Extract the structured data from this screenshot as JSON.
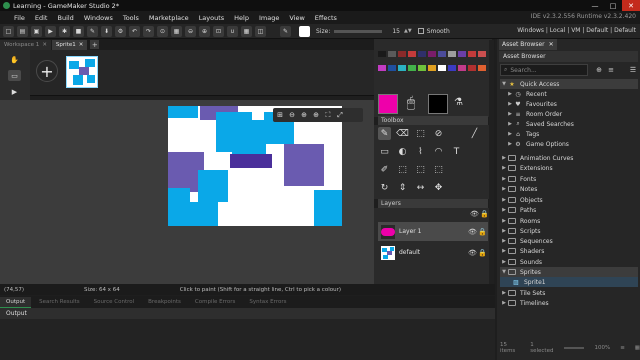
{
  "window": {
    "title": "Learning - GameMaker Studio 2*",
    "controls": [
      "—",
      "□",
      "✕"
    ]
  },
  "menu": {
    "items": [
      "File",
      "Edit",
      "Build",
      "Windows",
      "Tools",
      "Marketplace",
      "Layouts",
      "Help",
      "Image",
      "View",
      "Effects"
    ],
    "ide_info": "IDE v2.3.2.556  Runtime v2.3.2.420"
  },
  "toolbar": {
    "size_label": "Size:",
    "size_value": "15",
    "smooth_label": "Smooth",
    "layout_bar": "Windows | Local | VM | Default | Default"
  },
  "workspace_tabs": {
    "tabs": [
      "Workspace 1",
      "Sprite1"
    ],
    "add": "+"
  },
  "zoom_tools": [
    "⊞",
    "⊖",
    "⊕",
    "⊕",
    "⛶",
    "⤢"
  ],
  "toolbox": {
    "header": "Toolbox",
    "tools": [
      [
        "✎",
        "⌫",
        "⬚",
        "⊘",
        "╱"
      ],
      [
        "▭",
        "◐",
        "⌇",
        "◠",
        "T"
      ],
      [
        "✐",
        "⬚",
        "⬚",
        "⬚"
      ],
      [
        "↻",
        "⇕",
        "↔",
        "✥"
      ]
    ]
  },
  "layers": {
    "header": "Layers",
    "items": [
      {
        "name": "Layer 1"
      },
      {
        "name": "default"
      }
    ]
  },
  "status": {
    "coords": "(74,57)",
    "size": "Size: 64 x 64",
    "hint": "Click to paint (Shift for a straight line, Ctrl to pick a colour)"
  },
  "output": {
    "tabs": [
      "Output",
      "Search Results",
      "Source Control",
      "Breakpoints",
      "Compile Errors",
      "Syntax Errors"
    ],
    "title": "Output"
  },
  "asset_browser": {
    "tab": "Asset Browser",
    "title": "Asset Browser",
    "search_placeholder": "Search...",
    "quick_access": {
      "label": "Quick Access",
      "items": [
        "Recent",
        "Favourites",
        "Room Order",
        "Saved Searches",
        "Tags",
        "Game Options"
      ]
    },
    "groups": [
      "Animation Curves",
      "Extensions",
      "Fonts",
      "Notes",
      "Objects",
      "Paths",
      "Rooms",
      "Scripts",
      "Sequences",
      "Shaders",
      "Sounds",
      "Sprites",
      "Tile Sets",
      "Timelines"
    ],
    "sprite_child": "Sprite1",
    "footer_items": "15 items",
    "footer_selected": "1 selected",
    "footer_zoom": "100%"
  },
  "palette": {
    "swatches_row1": [
      "#1a1a1a",
      "#5a5a5a",
      "#8a2a2a",
      "#c43b3b",
      "#2f2f6a",
      "#7a1d6a",
      "#4b4b9a",
      "#9e9e9e",
      "#6a3ea8",
      "#c23b3b",
      "#cb4f4f"
    ],
    "swatches_row2": [
      "#c23bc2",
      "#1f4f9f",
      "#2bb2c2",
      "#42b24a",
      "#6ec23b",
      "#e0a020",
      "#ffffff",
      "#3b3bc2",
      "#c23b8a",
      "#b03030",
      "#e06030"
    ],
    "primary": "#ee00aa",
    "secondary": "#000000"
  },
  "colors": {
    "sprite_blue": "#0aa8e8",
    "sprite_purple": "#6a5bb0",
    "sprite_dark_purple": "#4a2f9a"
  }
}
